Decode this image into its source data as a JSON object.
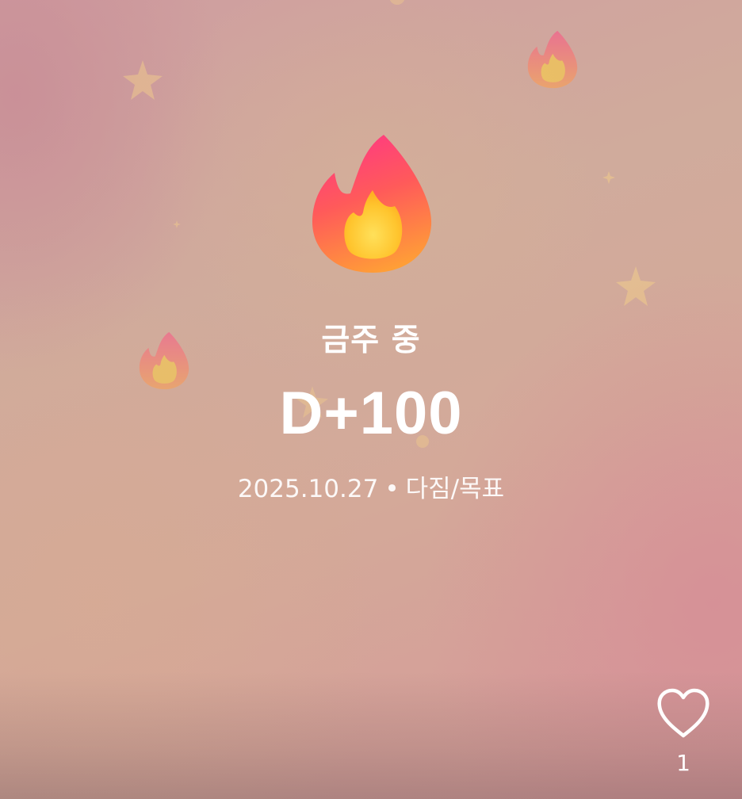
{
  "status_label": "금주 중",
  "dday": "D+100",
  "meta": {
    "date": "2025.10.27",
    "separator": "•",
    "category": "다짐/목표"
  },
  "like": {
    "icon": "heart-outline-icon",
    "count": "1"
  },
  "decorations": {
    "main_icon": "fire-icon",
    "background_icons": [
      "fire-icon",
      "star-icon",
      "sparkle-icon"
    ]
  },
  "colors": {
    "text": "#ffffff",
    "flame_outer_top": "#ff3f7a",
    "flame_outer_bottom": "#ff9a3a",
    "flame_inner": "#ffd23a",
    "star": "#f1c98a"
  }
}
